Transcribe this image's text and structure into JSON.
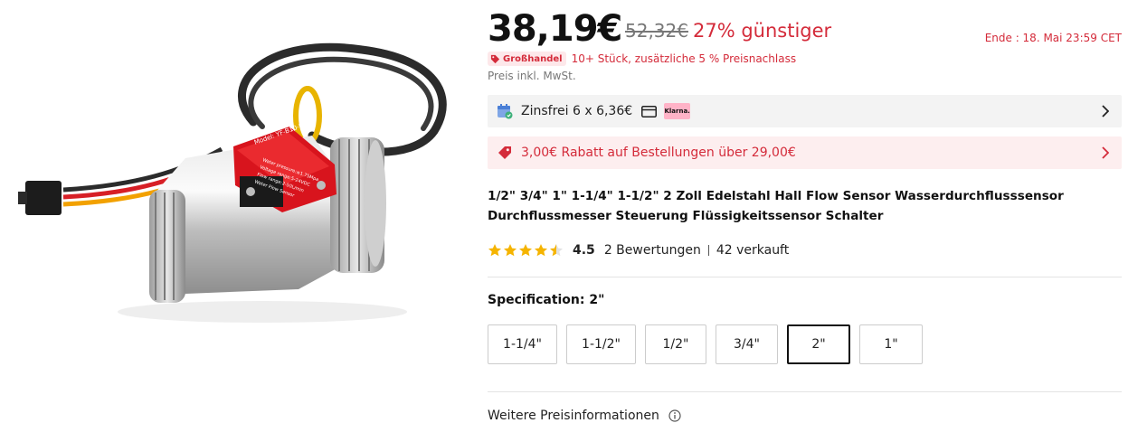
{
  "product_image": {
    "label_text": "Model: YF-B10-S",
    "label_lines": [
      "Water pressure:≤1.75Mpa",
      "Voltage range:5-24VDC",
      "Flow range:2-50L/min",
      "Water Flow Sensor"
    ]
  },
  "price": {
    "current": "38,19€",
    "original": "52,32€",
    "discount": "27% günstiger",
    "deal_end": "Ende :  18. Mai 23:59 CET"
  },
  "wholesale": {
    "badge": "Großhandel",
    "text": "10+ Stück, zusätzliche 5 % Preisnachlass"
  },
  "tax_note": "Preis inkl. MwSt.",
  "installment": {
    "text": "Zinsfrei 6 x 6,36€",
    "provider_badge": "Klarna.",
    "icons": [
      "calendar-icon",
      "credit-card-icon",
      "chevron-right-icon"
    ]
  },
  "coupon": {
    "text": "3,00€ Rabatt auf Bestellungen über 29,00€",
    "icons": [
      "tag-icon",
      "chevron-right-icon"
    ]
  },
  "title": "1/2\" 3/4\" 1\" 1-1/4\" 1-1/2\" 2 Zoll Edelstahl Hall Flow Sensor Wasserdurchflusssensor Durchflussmesser Steuerung Flüssigkeitssensor Schalter",
  "rating": {
    "score": "4.5",
    "stars_value": 4.5,
    "stars_max": 5,
    "reviews": "2 Bewertungen",
    "sold": "42 verkauft"
  },
  "specification": {
    "label": "Specification: 2\"",
    "options": [
      {
        "label": "1-1/4\"",
        "selected": false
      },
      {
        "label": "1-1/2\"",
        "selected": false
      },
      {
        "label": "1/2\"",
        "selected": false
      },
      {
        "label": "3/4\"",
        "selected": false
      },
      {
        "label": "2\"",
        "selected": true
      },
      {
        "label": "1\"",
        "selected": false
      }
    ]
  },
  "more_info": {
    "text": "Weitere Preisinformationen"
  },
  "colors": {
    "accent_red": "#d42b3a",
    "star_gold": "#f5b400",
    "klarna_pink": "#ffb3c7",
    "installment_bg": "#f3f3f3",
    "coupon_bg": "#fdeeef"
  }
}
